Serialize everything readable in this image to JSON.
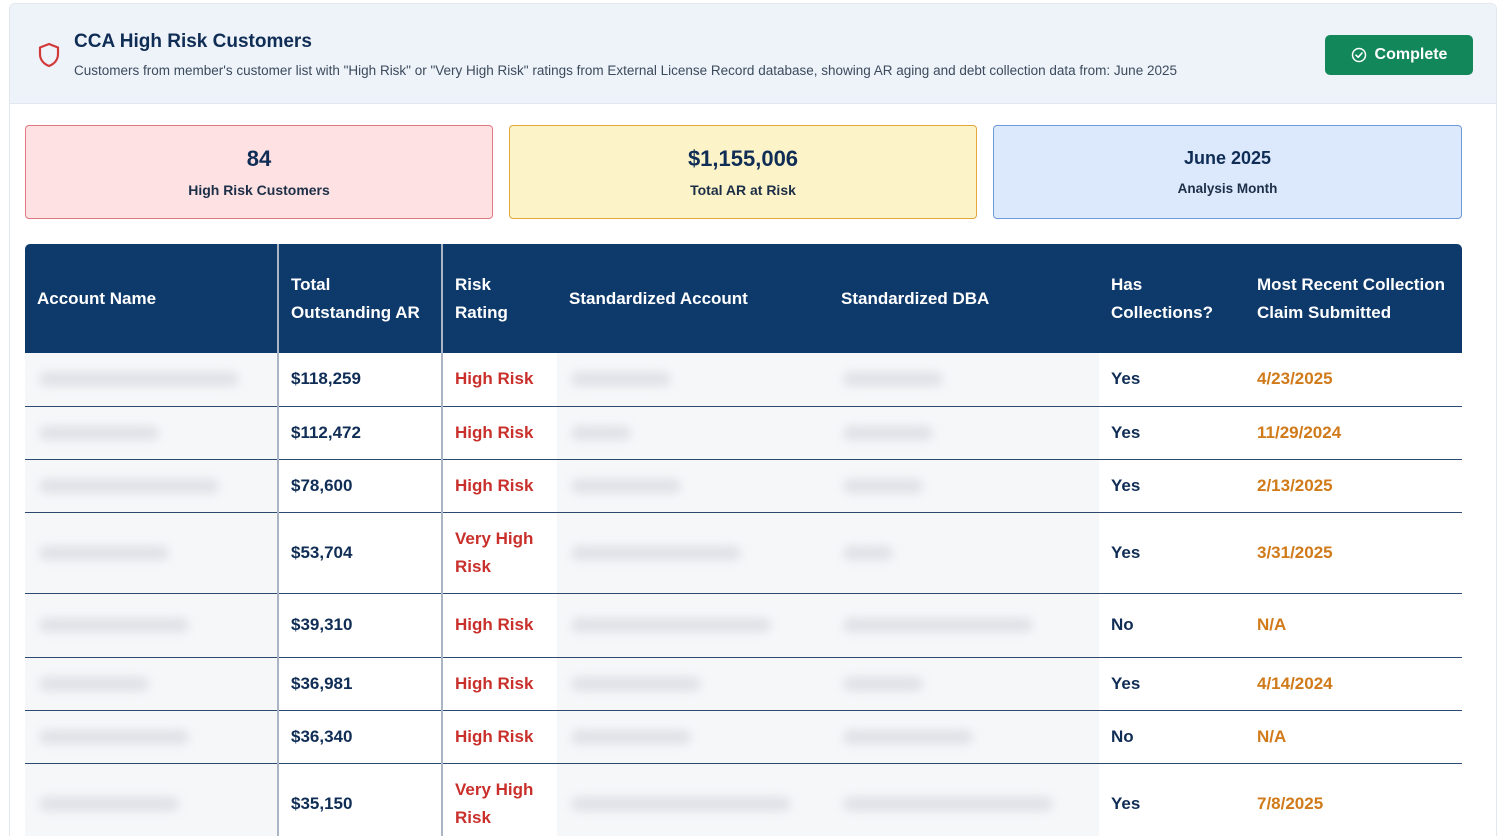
{
  "header": {
    "title": "CCA High Risk Customers",
    "subtitle": "Customers from member's customer list with \"High Risk\" or \"Very High Risk\" ratings from External License Record database, showing AR aging and debt collection data from: June 2025",
    "complete_label": "Complete",
    "icon": "shield-icon"
  },
  "stats": [
    {
      "value": "84",
      "label": "High Risk Customers"
    },
    {
      "value": "$1,155,006",
      "label": "Total AR at Risk"
    },
    {
      "value": "June 2025",
      "label": "Analysis Month"
    }
  ],
  "colors": {
    "header_bg": "#0e3a6b",
    "complete_button": "#12875a",
    "risk_text": "#c9302c",
    "date_text": "#d07a1a"
  },
  "table": {
    "columns": [
      "Account Name",
      "Total Outstanding AR",
      "Risk Rating",
      "Standardized Account",
      "Standardized DBA",
      "Has Collections?",
      "Most Recent Collection Claim Submitted"
    ],
    "rows": [
      {
        "ar": "$118,259",
        "risk": "High Risk",
        "collections": "Yes",
        "claim": "4/23/2025"
      },
      {
        "ar": "$112,472",
        "risk": "High Risk",
        "collections": "Yes",
        "claim": "11/29/2024"
      },
      {
        "ar": "$78,600",
        "risk": "High Risk",
        "collections": "Yes",
        "claim": "2/13/2025"
      },
      {
        "ar": "$53,704",
        "risk": "Very High Risk",
        "collections": "Yes",
        "claim": "3/31/2025"
      },
      {
        "ar": "$39,310",
        "risk": "High Risk",
        "collections": "No",
        "claim": "N/A"
      },
      {
        "ar": "$36,981",
        "risk": "High Risk",
        "collections": "Yes",
        "claim": "4/14/2024"
      },
      {
        "ar": "$36,340",
        "risk": "High Risk",
        "collections": "No",
        "claim": "N/A"
      },
      {
        "ar": "$35,150",
        "risk": "Very High Risk",
        "collections": "Yes",
        "claim": "7/8/2025"
      }
    ]
  }
}
